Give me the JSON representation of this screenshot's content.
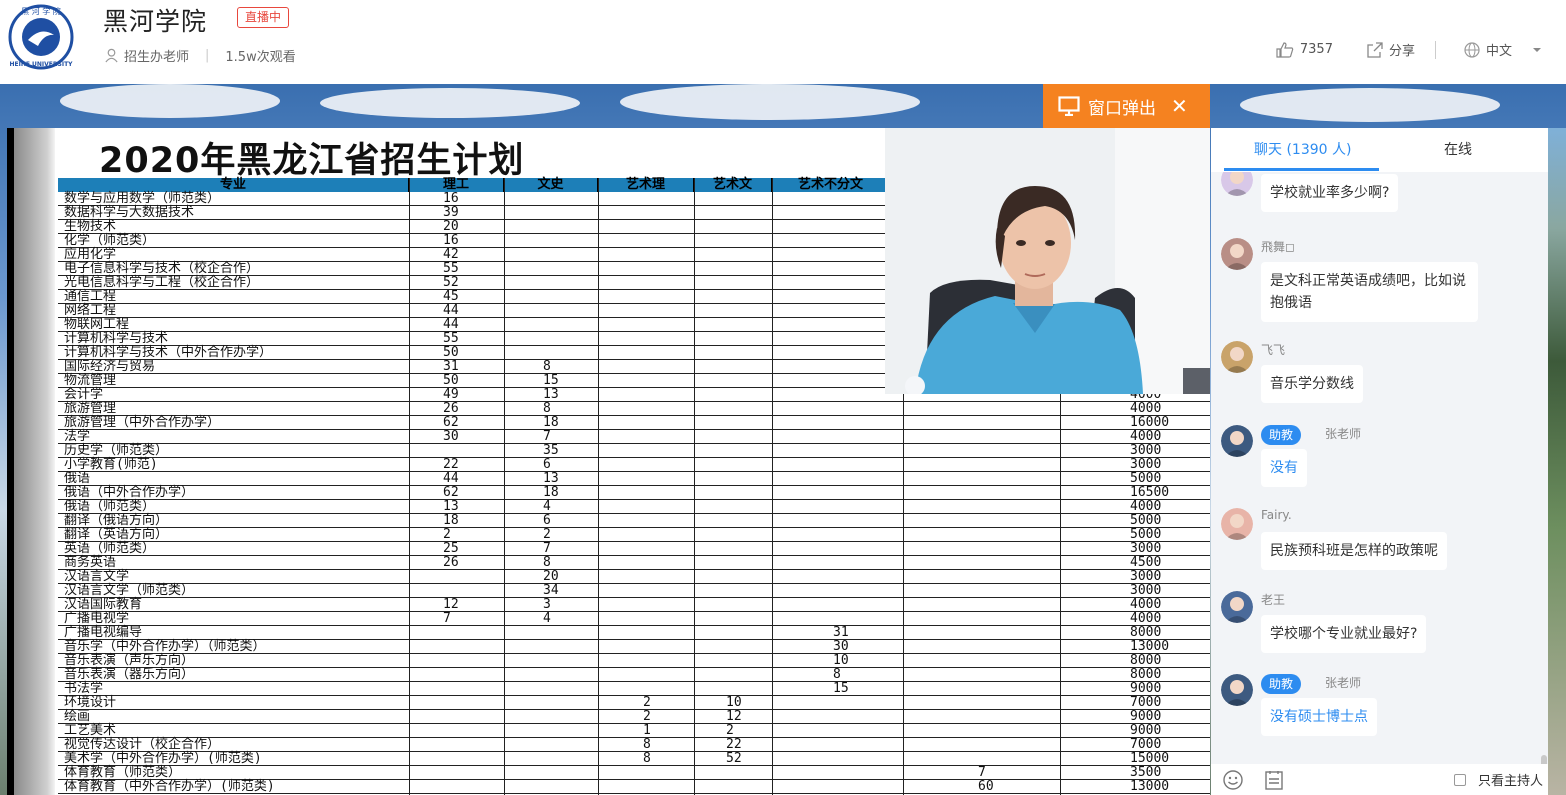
{
  "header": {
    "logo_text": "HEIHE UNIVERSITY",
    "title": "黑河学院",
    "live_badge": "直播中",
    "host": "招生办老师",
    "views": "1.5w次观看",
    "likes": "7357",
    "share": "分享",
    "language": "中文"
  },
  "stage": {
    "popout_label": "窗口弹出",
    "close_glyph": "✕"
  },
  "slide": {
    "title": "2020年黑龙江省招生计划",
    "columns": [
      "专业",
      "理工",
      "文史",
      "艺术理",
      "艺术文",
      "艺术不分文"
    ],
    "rows": [
      {
        "name": "数学与应用数学（师范类）",
        "lg": "16",
        "ws": "",
        "yl": "",
        "yw": "",
        "yb": "",
        "fee": ""
      },
      {
        "name": "数据科学与大数据技术",
        "lg": "39",
        "ws": "",
        "yl": "",
        "yw": "",
        "yb": "",
        "fee": ""
      },
      {
        "name": "生物技术",
        "lg": "20",
        "ws": "",
        "yl": "",
        "yw": "",
        "yb": "",
        "fee": ""
      },
      {
        "name": "化学（师范类）",
        "lg": "16",
        "ws": "",
        "yl": "",
        "yw": "",
        "yb": "",
        "fee": ""
      },
      {
        "name": "应用化学",
        "lg": "42",
        "ws": "",
        "yl": "",
        "yw": "",
        "yb": "",
        "fee": ""
      },
      {
        "name": "电子信息科学与技术（校企合作）",
        "lg": "55",
        "ws": "",
        "yl": "",
        "yw": "",
        "yb": "",
        "fee": ""
      },
      {
        "name": "光电信息科学与工程（校企合作）",
        "lg": "52",
        "ws": "",
        "yl": "",
        "yw": "",
        "yb": "",
        "fee": ""
      },
      {
        "name": "通信工程",
        "lg": "45",
        "ws": "",
        "yl": "",
        "yw": "",
        "yb": "",
        "fee": ""
      },
      {
        "name": "网络工程",
        "lg": "44",
        "ws": "",
        "yl": "",
        "yw": "",
        "yb": "",
        "fee": ""
      },
      {
        "name": "物联网工程",
        "lg": "44",
        "ws": "",
        "yl": "",
        "yw": "",
        "yb": "",
        "fee": ""
      },
      {
        "name": "计算机科学与技术",
        "lg": "55",
        "ws": "",
        "yl": "",
        "yw": "",
        "yb": "",
        "fee": ""
      },
      {
        "name": "计算机科学与技术（中外合作办学）",
        "lg": "50",
        "ws": "",
        "yl": "",
        "yw": "",
        "yb": "",
        "fee": ""
      },
      {
        "name": "国际经济与贸易",
        "lg": "31",
        "ws": "8",
        "yl": "",
        "yw": "",
        "yb": "",
        "fee": ""
      },
      {
        "name": "物流管理",
        "lg": "50",
        "ws": "15",
        "yl": "",
        "yw": "",
        "yb": "",
        "fee": ""
      },
      {
        "name": "会计学",
        "lg": "49",
        "ws": "13",
        "yl": "",
        "yw": "",
        "yb": "",
        "fee": "4000"
      },
      {
        "name": "旅游管理",
        "lg": "26",
        "ws": "8",
        "yl": "",
        "yw": "",
        "yb": "",
        "fee": "4000"
      },
      {
        "name": "旅游管理（中外合作办学）",
        "lg": "62",
        "ws": "18",
        "yl": "",
        "yw": "",
        "yb": "",
        "fee": "16000"
      },
      {
        "name": "法学",
        "lg": "30",
        "ws": "7",
        "yl": "",
        "yw": "",
        "yb": "",
        "fee": "4000"
      },
      {
        "name": "历史学（师范类）",
        "lg": "",
        "ws": "35",
        "yl": "",
        "yw": "",
        "yb": "",
        "fee": "3000"
      },
      {
        "name": "小学教育(师范)",
        "lg": "22",
        "ws": "6",
        "yl": "",
        "yw": "",
        "yb": "",
        "fee": "3000"
      },
      {
        "name": "俄语",
        "lg": "44",
        "ws": "13",
        "yl": "",
        "yw": "",
        "yb": "",
        "fee": "5000"
      },
      {
        "name": "俄语（中外合作办学）",
        "lg": "62",
        "ws": "18",
        "yl": "",
        "yw": "",
        "yb": "",
        "fee": "16500"
      },
      {
        "name": "俄语（师范类）",
        "lg": "13",
        "ws": "4",
        "yl": "",
        "yw": "",
        "yb": "",
        "fee": "4000"
      },
      {
        "name": "翻译（俄语方向）",
        "lg": "18",
        "ws": "6",
        "yl": "",
        "yw": "",
        "yb": "",
        "fee": "5000"
      },
      {
        "name": "翻译（英语方向）",
        "lg": "2",
        "ws": "2",
        "yl": "",
        "yw": "",
        "yb": "",
        "fee": "5000"
      },
      {
        "name": "英语（师范类）",
        "lg": "25",
        "ws": "7",
        "yl": "",
        "yw": "",
        "yb": "",
        "fee": "3000"
      },
      {
        "name": "商务英语",
        "lg": "26",
        "ws": "8",
        "yl": "",
        "yw": "",
        "yb": "",
        "fee": "4500"
      },
      {
        "name": "汉语言文学",
        "lg": "",
        "ws": "20",
        "yl": "",
        "yw": "",
        "yb": "",
        "fee": "3000"
      },
      {
        "name": "汉语言文学（师范类）",
        "lg": "",
        "ws": "34",
        "yl": "",
        "yw": "",
        "yb": "",
        "fee": "3000"
      },
      {
        "name": "汉语国际教育",
        "lg": "12",
        "ws": "3",
        "yl": "",
        "yw": "",
        "yb": "",
        "fee": "4000"
      },
      {
        "name": "广播电视学",
        "lg": "7",
        "ws": "4",
        "yl": "",
        "yw": "",
        "yb": "",
        "fee": "4000"
      },
      {
        "name": "广播电视编导",
        "lg": "",
        "ws": "",
        "yl": "",
        "yw": "",
        "yb": "31",
        "fee": "8000"
      },
      {
        "name": "音乐学（中外合作办学）（师范类）",
        "lg": "",
        "ws": "",
        "yl": "",
        "yw": "",
        "yb": "30",
        "fee": "13000"
      },
      {
        "name": "音乐表演（声乐方向）",
        "lg": "",
        "ws": "",
        "yl": "",
        "yw": "",
        "yb": "10",
        "fee": "8000"
      },
      {
        "name": "音乐表演（器乐方向）",
        "lg": "",
        "ws": "",
        "yl": "",
        "yw": "",
        "yb": "8",
        "fee": "8000"
      },
      {
        "name": "书法学",
        "lg": "",
        "ws": "",
        "yl": "",
        "yw": "",
        "yb": "15",
        "fee": "9000"
      },
      {
        "name": "环境设计",
        "lg": "",
        "ws": "",
        "yl": "2",
        "yw": "10",
        "yb": "",
        "fee": "7000"
      },
      {
        "name": "绘画",
        "lg": "",
        "ws": "",
        "yl": "2",
        "yw": "12",
        "yb": "",
        "fee": "9000"
      },
      {
        "name": "工艺美术",
        "lg": "",
        "ws": "",
        "yl": "1",
        "yw": "2",
        "yb": "",
        "fee": "9000"
      },
      {
        "name": "视觉传达设计（校企合作）",
        "lg": "",
        "ws": "",
        "yl": "8",
        "yw": "22",
        "yb": "",
        "fee": "7000"
      },
      {
        "name": "美术学（中外合作办学）(师范类)",
        "lg": "",
        "ws": "",
        "yl": "8",
        "yw": "52",
        "yb": "",
        "fee": "15000"
      },
      {
        "name": "体育教育（师范类）",
        "lg": "",
        "ws": "",
        "yl": "",
        "yw": "",
        "yb": "",
        "sp": "7",
        "fee": "3500"
      },
      {
        "name": "体育教育（中外合作办学）(师范类)",
        "lg": "",
        "ws": "",
        "yl": "",
        "yw": "",
        "yb": "",
        "sp": "60",
        "fee": "13000"
      }
    ]
  },
  "chat": {
    "tab_chat": "聊天 (1390 人)",
    "tab_online": "在线",
    "messages": [
      {
        "user": "",
        "role": "",
        "text": "学校就业率多少啊?",
        "avatar": "#d8c8e8",
        "staff": false
      },
      {
        "user": "飛舞◻",
        "role": "",
        "text": "是文科正常英语成绩吧，比如说抱俄语",
        "avatar": "#b98e86",
        "staff": false
      },
      {
        "user": "飞飞",
        "role": "",
        "text": "音乐学分数线",
        "avatar": "#c9a36a",
        "staff": false
      },
      {
        "user": "张老师",
        "role": "助教",
        "text": "没有",
        "avatar": "#3d5a80",
        "staff": true
      },
      {
        "user": "Fairy.",
        "role": "",
        "text": "民族预科班是怎样的政策呢",
        "avatar": "#e8b4a8",
        "staff": false
      },
      {
        "user": "老王",
        "role": "",
        "text": "学校哪个专业就业最好?",
        "avatar": "#4a6a9a",
        "staff": false
      },
      {
        "user": "张老师",
        "role": "助教",
        "text": "没有硕士博士点",
        "avatar": "#3d5a80",
        "staff": true
      }
    ],
    "only_host": "只看主持人"
  }
}
